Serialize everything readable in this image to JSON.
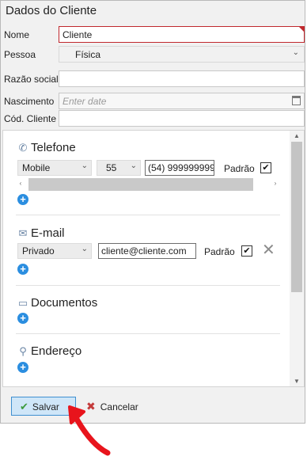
{
  "form": {
    "title": "Dados do Cliente",
    "fields": {
      "nome": {
        "label": "Nome",
        "value": "Cliente"
      },
      "pessoa": {
        "label": "Pessoa",
        "value": "Física"
      },
      "razao": {
        "label": "Razão social",
        "value": ""
      },
      "nascimento": {
        "label": "Nascimento",
        "placeholder": "Enter date"
      },
      "cod": {
        "label": "Cód. Cliente",
        "value": ""
      }
    }
  },
  "sections": {
    "telefone": {
      "title": "Telefone",
      "type": "Mobile",
      "ddi": "55",
      "number": "(54) 999999999",
      "padrao_label": "Padrão",
      "padrao_checked": true
    },
    "email": {
      "title": "E-mail",
      "type": "Privado",
      "address": "cliente@cliente.com",
      "padrao_label": "Padrão",
      "padrao_checked": true
    },
    "documentos": {
      "title": "Documentos"
    },
    "endereco": {
      "title": "Endereço"
    }
  },
  "actions": {
    "save_label": "Salvar",
    "cancel_label": "Cancelar"
  },
  "colors": {
    "accent": "#2b8ee0",
    "annotation_arrow": "#e8141c",
    "error_border": "#c0282d"
  }
}
